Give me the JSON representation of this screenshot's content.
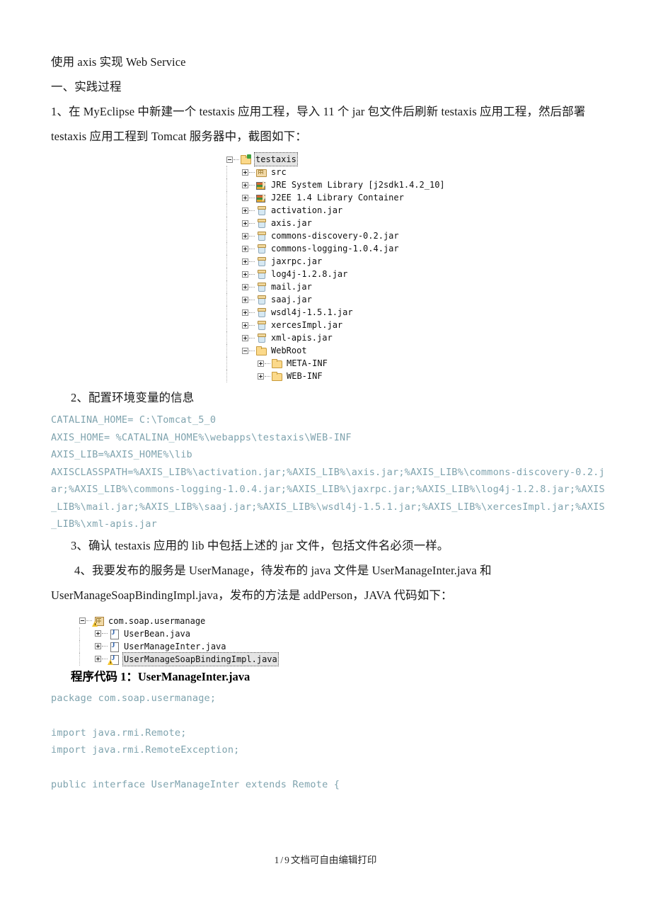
{
  "document": {
    "title": "使用 axis 实现 Web Service",
    "section_heading": "一、实践过程",
    "para1": "1、在 MyEclipse 中新建一个 testaxis 应用工程，导入 11 个 jar 包文件后刷新 testaxis 应用工程，然后部署 testaxis 应用工程到 Tomcat 服务器中，截图如下：",
    "para2": "2、配置环境变量的信息",
    "para3": "3、确认 testaxis 应用的 lib 中包括上述的 jar 文件，包括文件名必须一样。",
    "para4": "4、我要发布的服务是 UserManage，待发布的 java 文件是 UserManageInter.java 和 UserManageSoapBindingImpl.java，发布的方法是 addPerson，JAVA 代码如下：",
    "code_heading": "程序代码 1：UserManageInter.java"
  },
  "project_tree": {
    "nodes": [
      {
        "indent": 0,
        "expander": "minus",
        "icon": "folder-project-icon",
        "label": "testaxis",
        "selected": true
      },
      {
        "indent": 1,
        "expander": "plus",
        "icon": "source-folder-icon",
        "label": "src",
        "selected": false
      },
      {
        "indent": 1,
        "expander": "plus",
        "icon": "library-icon",
        "label": "JRE System Library [j2sdk1.4.2_10]",
        "selected": false
      },
      {
        "indent": 1,
        "expander": "plus",
        "icon": "library-icon",
        "label": "J2EE 1.4 Library Container",
        "selected": false
      },
      {
        "indent": 1,
        "expander": "plus",
        "icon": "jar-icon",
        "label": "activation.jar",
        "selected": false
      },
      {
        "indent": 1,
        "expander": "plus",
        "icon": "jar-icon",
        "label": "axis.jar",
        "selected": false
      },
      {
        "indent": 1,
        "expander": "plus",
        "icon": "jar-icon",
        "label": "commons-discovery-0.2.jar",
        "selected": false
      },
      {
        "indent": 1,
        "expander": "plus",
        "icon": "jar-icon",
        "label": "commons-logging-1.0.4.jar",
        "selected": false
      },
      {
        "indent": 1,
        "expander": "plus",
        "icon": "jar-icon",
        "label": "jaxrpc.jar",
        "selected": false
      },
      {
        "indent": 1,
        "expander": "plus",
        "icon": "jar-icon",
        "label": "log4j-1.2.8.jar",
        "selected": false
      },
      {
        "indent": 1,
        "expander": "plus",
        "icon": "jar-icon",
        "label": "mail.jar",
        "selected": false
      },
      {
        "indent": 1,
        "expander": "plus",
        "icon": "jar-icon",
        "label": "saaj.jar",
        "selected": false
      },
      {
        "indent": 1,
        "expander": "plus",
        "icon": "jar-icon",
        "label": "wsdl4j-1.5.1.jar",
        "selected": false
      },
      {
        "indent": 1,
        "expander": "plus",
        "icon": "jar-icon",
        "label": "xercesImpl.jar",
        "selected": false
      },
      {
        "indent": 1,
        "expander": "plus",
        "icon": "jar-icon",
        "label": "xml-apis.jar",
        "selected": false
      },
      {
        "indent": 1,
        "expander": "minus",
        "icon": "folder-icon",
        "label": "WebRoot",
        "selected": false
      },
      {
        "indent": 2,
        "expander": "plus",
        "icon": "folder-icon",
        "label": "META-INF",
        "selected": false
      },
      {
        "indent": 2,
        "expander": "plus",
        "icon": "folder-icon",
        "label": "WEB-INF",
        "selected": false
      }
    ]
  },
  "package_tree": {
    "nodes": [
      {
        "indent": 0,
        "expander": "minus",
        "icon": "package-icon",
        "label": "com.soap.usermanage",
        "warning": true,
        "selected": false
      },
      {
        "indent": 1,
        "expander": "plus",
        "icon": "java-file-icon",
        "label": "UserBean.java",
        "warning": false,
        "selected": false
      },
      {
        "indent": 1,
        "expander": "plus",
        "icon": "java-file-icon",
        "label": "UserManageInter.java",
        "warning": false,
        "selected": false
      },
      {
        "indent": 1,
        "expander": "plus",
        "icon": "java-file-icon",
        "label": "UserManageSoapBindingImpl.java",
        "warning": true,
        "selected": true
      }
    ]
  },
  "env_config": {
    "lines": [
      "CATALINA_HOME= C:\\Tomcat_5_0",
      "AXIS_HOME= %CATALINA_HOME%\\webapps\\testaxis\\WEB-INF",
      "AXIS_LIB=%AXIS_HOME%\\lib",
      "AXISCLASSPATH=%AXIS_LIB%\\activation.jar;%AXIS_LIB%\\axis.jar;%AXIS_LIB%\\commons-discovery-0.2.jar;%AXIS_LIB%\\commons-logging-1.0.4.jar;%AXIS_LIB%\\jaxrpc.jar;%AXIS_LIB%\\log4j-1.2.8.jar;%AXIS_LIB%\\mail.jar;%AXIS_LIB%\\saaj.jar;%AXIS_LIB%\\wsdl4j-1.5.1.jar;%AXIS_LIB%\\xercesImpl.jar;%AXIS_LIB%\\xml-apis.jar"
    ]
  },
  "java_code": {
    "line1": "package com.soap.usermanage;",
    "line2": "import java.rmi.Remote;",
    "line3": "import java.rmi.RemoteException;",
    "line4": "public interface UserManageInter extends Remote {"
  },
  "footer": {
    "page_current": "1",
    "separator": "/",
    "page_total": "9",
    "note": "文档可自由编辑打印"
  },
  "colors": {
    "code_text": "#7FA3AE",
    "body_text": "#1a1a1a"
  }
}
